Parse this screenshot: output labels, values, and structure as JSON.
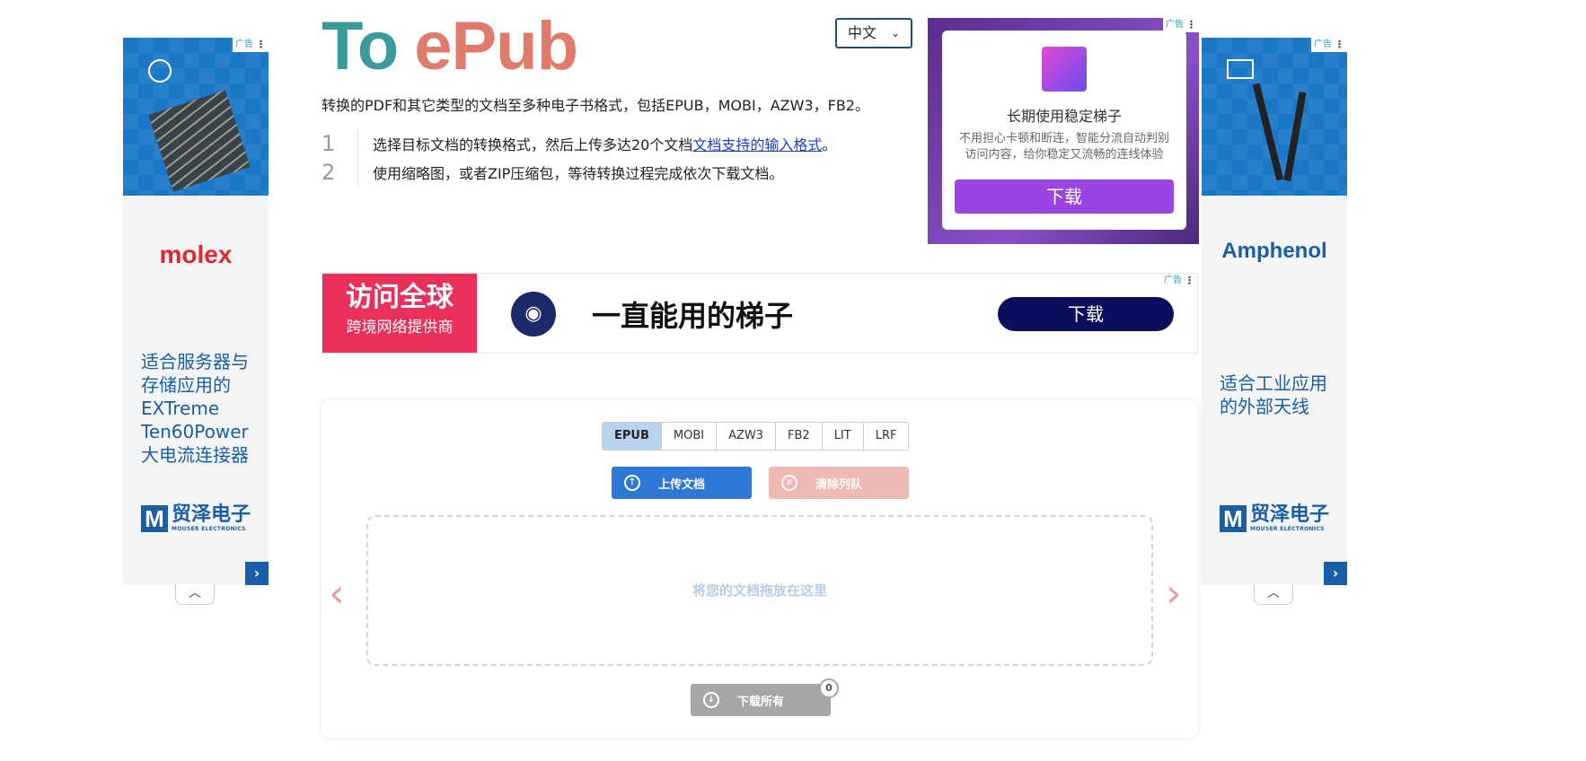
{
  "logo": {
    "part1": "To",
    "part2": "ePub"
  },
  "lang_select": {
    "value": "中文",
    "icon": "chevron-down-icon"
  },
  "intro": "转换的PDF和其它类型的文档至多种电子书格式，包括EPUB，MOBI，AZW3，FB2。",
  "steps": [
    {
      "num": "1",
      "text_before": "选择目标文档的转换格式，然后上传多达20个文档",
      "link": "文档支持的输入格式",
      "text_after": "。"
    },
    {
      "num": "2",
      "text": "使用缩略图，或者ZIP压缩包，等待转换过程完成依次下载文档。"
    }
  ],
  "ad_tag": "广告",
  "left_ad": {
    "brand": "molex",
    "desc": "适合服务器与存储应用的EXTreme Ten60Power大电流连接器",
    "mouser_cn": "贸泽电子",
    "mouser_en": "MOUSER ELECTRONICS",
    "brand_color": "#e3262f"
  },
  "right_ad": {
    "brand": "Amphenol",
    "desc": "适合工业应用的外部天线",
    "mouser_cn": "贸泽电子",
    "mouser_en": "MOUSER ELECTRONICS",
    "brand_color": "#1b5ea5"
  },
  "top_right_ad": {
    "title": "长期使用稳定梯子",
    "sub": "不用担心卡顿和断连，智能分流自动判别访问内容，给你稳定又流畅的连线体验",
    "download": "下载"
  },
  "banner_ad": {
    "red_line1": "访问全球",
    "red_line2": "跨境网络提供商",
    "headline": "一直能用的梯子",
    "download": "下载"
  },
  "converter": {
    "tabs": [
      "EPUB",
      "MOBI",
      "AZW3",
      "FB2",
      "LIT",
      "LRF"
    ],
    "active_tab": "EPUB",
    "upload": "上传文档",
    "clear": "清除列队",
    "dropzone": "将您的文档拖放在这里",
    "download_all": "下载所有",
    "count": "0"
  },
  "colors": {
    "upload": "#2f78d8",
    "clear": "#efb9b4",
    "download": "#a7a7a7",
    "accent_teal": "#3a9b98",
    "accent_coral": "#e07a6a"
  }
}
